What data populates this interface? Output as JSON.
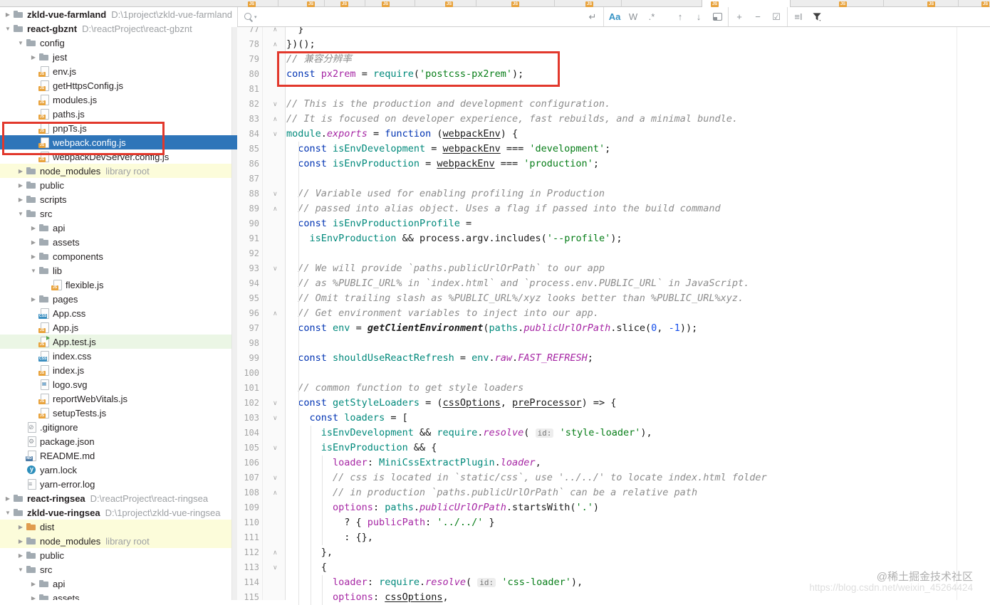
{
  "find_bar": {
    "search_placeholder": "",
    "search_value": "",
    "newline_label": "↵",
    "match_case_label": "Aa",
    "whole_words_label": "W",
    "regex_label": ".*",
    "prev_label": "↑",
    "next_label": "↓",
    "add_selection_label": "+",
    "remove_selection_label": "−",
    "select_all_label": "☑",
    "filter_lines_label": "≡I",
    "icons": [
      "search-icon",
      "search-history-caret",
      "newline-icon",
      "match-case",
      "whole-words",
      "regex",
      "previous-occurrence",
      "next-occurrence",
      "open-in-find-window",
      "add-selection",
      "remove-selection",
      "select-all-occurrences",
      "filter-search-lines",
      "filter"
    ]
  },
  "project_tree": {
    "items": [
      {
        "label": "zkld-vue-farmland",
        "path": "D:\\1project\\zkld-vue-farmland",
        "depth": 0,
        "arrow": "right",
        "icon": "folder",
        "bold": true
      },
      {
        "label": "react-gbznt",
        "path": "D:\\reactProject\\react-gbznt",
        "depth": 0,
        "arrow": "down",
        "icon": "folder",
        "bold": true
      },
      {
        "label": "config",
        "depth": 1,
        "arrow": "down",
        "icon": "folder"
      },
      {
        "label": "jest",
        "depth": 2,
        "arrow": "right",
        "icon": "folder"
      },
      {
        "label": "env.js",
        "depth": 2,
        "icon": "js"
      },
      {
        "label": "getHttpsConfig.js",
        "depth": 2,
        "icon": "js"
      },
      {
        "label": "modules.js",
        "depth": 2,
        "icon": "js"
      },
      {
        "label": "paths.js",
        "depth": 2,
        "icon": "js"
      },
      {
        "label": "pnpTs.js",
        "depth": 2,
        "icon": "js"
      },
      {
        "label": "webpack.config.js",
        "depth": 2,
        "icon": "js",
        "selected": true
      },
      {
        "label": "webpackDevServer.config.js",
        "depth": 2,
        "icon": "js"
      },
      {
        "label": "node_modules",
        "badge": "library root",
        "depth": 1,
        "arrow": "right",
        "icon": "folder",
        "bg": "yellow"
      },
      {
        "label": "public",
        "depth": 1,
        "arrow": "right",
        "icon": "folder"
      },
      {
        "label": "scripts",
        "depth": 1,
        "arrow": "right",
        "icon": "folder"
      },
      {
        "label": "src",
        "depth": 1,
        "arrow": "down",
        "icon": "folder"
      },
      {
        "label": "api",
        "depth": 2,
        "arrow": "right",
        "icon": "folder"
      },
      {
        "label": "assets",
        "depth": 2,
        "arrow": "right",
        "icon": "folder"
      },
      {
        "label": "components",
        "depth": 2,
        "arrow": "right",
        "icon": "folder"
      },
      {
        "label": "lib",
        "depth": 2,
        "arrow": "down",
        "icon": "folder"
      },
      {
        "label": "flexible.js",
        "depth": 3,
        "icon": "js"
      },
      {
        "label": "pages",
        "depth": 2,
        "arrow": "right",
        "icon": "folder"
      },
      {
        "label": "App.css",
        "depth": 2,
        "icon": "css"
      },
      {
        "label": "App.js",
        "depth": 2,
        "icon": "js"
      },
      {
        "label": "App.test.js",
        "depth": 2,
        "icon": "jstest",
        "bg": "green"
      },
      {
        "label": "index.css",
        "depth": 2,
        "icon": "css"
      },
      {
        "label": "index.js",
        "depth": 2,
        "icon": "js"
      },
      {
        "label": "logo.svg",
        "depth": 2,
        "icon": "img"
      },
      {
        "label": "reportWebVitals.js",
        "depth": 2,
        "icon": "js"
      },
      {
        "label": "setupTests.js",
        "depth": 2,
        "icon": "js"
      },
      {
        "label": ".gitignore",
        "depth": 1,
        "icon": "git"
      },
      {
        "label": "package.json",
        "depth": 1,
        "icon": "json"
      },
      {
        "label": "README.md",
        "depth": 1,
        "icon": "md"
      },
      {
        "label": "yarn.lock",
        "depth": 1,
        "icon": "yarn"
      },
      {
        "label": "yarn-error.log",
        "depth": 1,
        "icon": "log"
      },
      {
        "label": "react-ringsea",
        "path": "D:\\reactProject\\react-ringsea",
        "depth": 0,
        "arrow": "right",
        "icon": "folder",
        "bold": true
      },
      {
        "label": "zkld-vue-ringsea",
        "path": "D:\\1project\\zkld-vue-ringsea",
        "depth": 0,
        "arrow": "down",
        "icon": "folder",
        "bold": true
      },
      {
        "label": "dist",
        "depth": 1,
        "arrow": "right",
        "icon": "folder-orange",
        "bg": "yellow"
      },
      {
        "label": "node_modules",
        "badge": "library root",
        "depth": 1,
        "arrow": "right",
        "icon": "folder",
        "bg": "yellow"
      },
      {
        "label": "public",
        "depth": 1,
        "arrow": "right",
        "icon": "folder"
      },
      {
        "label": "src",
        "depth": 1,
        "arrow": "down",
        "icon": "folder"
      },
      {
        "label": "api",
        "depth": 2,
        "arrow": "right",
        "icon": "folder"
      },
      {
        "label": "assets",
        "depth": 2,
        "arrow": "right",
        "icon": "folder"
      }
    ]
  },
  "editor": {
    "file": "webpack.config.js",
    "lines": [
      {
        "n": 77,
        "f": "e",
        "s": [
          [
            "  }",
            "d"
          ]
        ]
      },
      {
        "n": 78,
        "f": "e",
        "s": [
          [
            "})();",
            "d"
          ]
        ]
      },
      {
        "n": 79,
        "s": [
          [
            "// 兼容分辨率",
            "c"
          ]
        ]
      },
      {
        "n": 80,
        "s": [
          [
            "const ",
            "k"
          ],
          [
            "px2rem",
            "p"
          ],
          [
            " = ",
            "d"
          ],
          [
            "require",
            "t"
          ],
          [
            "(",
            "d"
          ],
          [
            "'postcss-px2rem'",
            "s"
          ],
          [
            ");",
            "d"
          ]
        ]
      },
      {
        "n": 81,
        "s": []
      },
      {
        "n": 82,
        "f": "s",
        "s": [
          [
            "// This is the production and development configuration.",
            "c"
          ]
        ]
      },
      {
        "n": 83,
        "f": "e",
        "s": [
          [
            "// It is focused on developer experience, fast rebuilds, and a minimal bundle.",
            "c"
          ]
        ]
      },
      {
        "n": 84,
        "f": "s",
        "s": [
          [
            "module",
            "t"
          ],
          [
            ".",
            "d"
          ],
          [
            "exports",
            "pi"
          ],
          [
            " = ",
            "d"
          ],
          [
            "function",
            "k"
          ],
          [
            " (",
            "d"
          ],
          [
            "webpackEnv",
            "u"
          ],
          [
            ") {",
            "d"
          ]
        ]
      },
      {
        "n": 85,
        "s": [
          [
            "  ",
            "d"
          ],
          [
            "const ",
            "k"
          ],
          [
            "isEnvDevelopment",
            "t"
          ],
          [
            " = ",
            "d"
          ],
          [
            "webpackEnv",
            "u"
          ],
          [
            " === ",
            "d"
          ],
          [
            "'development'",
            "s"
          ],
          [
            ";",
            "d"
          ]
        ]
      },
      {
        "n": 86,
        "s": [
          [
            "  ",
            "d"
          ],
          [
            "const ",
            "k"
          ],
          [
            "isEnvProduction",
            "t"
          ],
          [
            " = ",
            "d"
          ],
          [
            "webpackEnv",
            "u"
          ],
          [
            " === ",
            "d"
          ],
          [
            "'production'",
            "s"
          ],
          [
            ";",
            "d"
          ]
        ]
      },
      {
        "n": 87,
        "s": []
      },
      {
        "n": 88,
        "f": "s",
        "s": [
          [
            "  // Variable used for enabling profiling in Production",
            "c"
          ]
        ]
      },
      {
        "n": 89,
        "f": "e",
        "s": [
          [
            "  // passed into alias object. Uses a flag if passed into the build command",
            "c"
          ]
        ]
      },
      {
        "n": 90,
        "s": [
          [
            "  ",
            "d"
          ],
          [
            "const ",
            "k"
          ],
          [
            "isEnvProductionProfile",
            "t"
          ],
          [
            " =",
            "d"
          ]
        ]
      },
      {
        "n": 91,
        "s": [
          [
            "    ",
            "d"
          ],
          [
            "isEnvProduction",
            "t"
          ],
          [
            " && ",
            "d"
          ],
          [
            "process.argv",
            "d"
          ],
          [
            ".",
            "d"
          ],
          [
            "includes",
            "d"
          ],
          [
            "(",
            "d"
          ],
          [
            "'--profile'",
            "s"
          ],
          [
            ");",
            "d"
          ]
        ]
      },
      {
        "n": 92,
        "s": []
      },
      {
        "n": 93,
        "f": "s",
        "s": [
          [
            "  // We will provide `paths.publicUrlOrPath` to our app",
            "c"
          ]
        ]
      },
      {
        "n": 94,
        "s": [
          [
            "  // as %PUBLIC_URL% in `index.html` and `process.env.PUBLIC_URL` in JavaScript.",
            "c"
          ]
        ]
      },
      {
        "n": 95,
        "s": [
          [
            "  // Omit trailing slash as %PUBLIC_URL%/xyz looks better than %PUBLIC_URL%xyz.",
            "c"
          ]
        ]
      },
      {
        "n": 96,
        "f": "e",
        "s": [
          [
            "  // Get environment variables to inject into our app.",
            "c"
          ]
        ]
      },
      {
        "n": 97,
        "s": [
          [
            "  ",
            "d"
          ],
          [
            "const ",
            "k"
          ],
          [
            "env",
            "t"
          ],
          [
            " = ",
            "d"
          ],
          [
            "getClientEnvironment",
            "fi2"
          ],
          [
            "(",
            "d"
          ],
          [
            "paths",
            "t"
          ],
          [
            ".",
            "d"
          ],
          [
            "publicUrlOrPath",
            "pi"
          ],
          [
            ".",
            "d"
          ],
          [
            "slice",
            "d"
          ],
          [
            "(",
            "d"
          ],
          [
            "0",
            "n"
          ],
          [
            ", ",
            "d"
          ],
          [
            "-1",
            "n"
          ],
          [
            "));",
            "d"
          ]
        ]
      },
      {
        "n": 98,
        "s": []
      },
      {
        "n": 99,
        "s": [
          [
            "  ",
            "d"
          ],
          [
            "const ",
            "k"
          ],
          [
            "shouldUseReactRefresh",
            "t"
          ],
          [
            " = ",
            "d"
          ],
          [
            "env",
            "t"
          ],
          [
            ".",
            "d"
          ],
          [
            "raw",
            "pi"
          ],
          [
            ".",
            "d"
          ],
          [
            "FAST_REFRESH",
            "pi"
          ],
          [
            ";",
            "d"
          ]
        ]
      },
      {
        "n": 100,
        "s": []
      },
      {
        "n": 101,
        "s": [
          [
            "  // common function to get style loaders",
            "c"
          ]
        ]
      },
      {
        "n": 102,
        "f": "s",
        "s": [
          [
            "  ",
            "d"
          ],
          [
            "const ",
            "k"
          ],
          [
            "getStyleLoaders",
            "t"
          ],
          [
            " = (",
            "d"
          ],
          [
            "cssOptions",
            "u"
          ],
          [
            ", ",
            "d"
          ],
          [
            "preProcessor",
            "u"
          ],
          [
            ") => {",
            "d"
          ]
        ]
      },
      {
        "n": 103,
        "f": "s",
        "s": [
          [
            "    ",
            "d"
          ],
          [
            "const ",
            "k"
          ],
          [
            "loaders",
            "t"
          ],
          [
            " = [",
            "d"
          ]
        ]
      },
      {
        "n": 104,
        "s": [
          [
            "      ",
            "d"
          ],
          [
            "isEnvDevelopment",
            "t"
          ],
          [
            " && ",
            "d"
          ],
          [
            "require",
            "t"
          ],
          [
            ".",
            "d"
          ],
          [
            "resolve",
            "pi"
          ],
          [
            "( ",
            "d"
          ],
          [
            "id:",
            "h"
          ],
          [
            " ",
            "d"
          ],
          [
            "'style-loader'",
            "s"
          ],
          [
            "),",
            "d"
          ]
        ]
      },
      {
        "n": 105,
        "f": "s",
        "s": [
          [
            "      ",
            "d"
          ],
          [
            "isEnvProduction",
            "t"
          ],
          [
            " && {",
            "d"
          ]
        ]
      },
      {
        "n": 106,
        "s": [
          [
            "        ",
            "d"
          ],
          [
            "loader",
            "p"
          ],
          [
            ": ",
            "d"
          ],
          [
            "MiniCssExtractPlugin",
            "t"
          ],
          [
            ".",
            "d"
          ],
          [
            "loader",
            "pi"
          ],
          [
            ",",
            "d"
          ]
        ]
      },
      {
        "n": 107,
        "f": "s",
        "s": [
          [
            "        // css is located in `static/css`, use '../../' to locate index.html folder",
            "c"
          ]
        ]
      },
      {
        "n": 108,
        "f": "e",
        "s": [
          [
            "        // in production `paths.publicUrlOrPath` can be a relative path",
            "c"
          ]
        ]
      },
      {
        "n": 109,
        "s": [
          [
            "        ",
            "d"
          ],
          [
            "options",
            "p"
          ],
          [
            ": ",
            "d"
          ],
          [
            "paths",
            "t"
          ],
          [
            ".",
            "d"
          ],
          [
            "publicUrlOrPath",
            "pi"
          ],
          [
            ".",
            "d"
          ],
          [
            "startsWith",
            "d"
          ],
          [
            "(",
            "d"
          ],
          [
            "'.'",
            "s"
          ],
          [
            ")",
            "d"
          ]
        ]
      },
      {
        "n": 110,
        "s": [
          [
            "          ? { ",
            "d"
          ],
          [
            "publicPath",
            "p"
          ],
          [
            ": ",
            "d"
          ],
          [
            "'../../'",
            "s"
          ],
          [
            " }",
            "d"
          ]
        ]
      },
      {
        "n": 111,
        "s": [
          [
            "          : {},",
            "d"
          ]
        ]
      },
      {
        "n": 112,
        "f": "e",
        "s": [
          [
            "      },",
            "d"
          ]
        ]
      },
      {
        "n": 113,
        "f": "s",
        "s": [
          [
            "      {",
            "d"
          ]
        ]
      },
      {
        "n": 114,
        "s": [
          [
            "        ",
            "d"
          ],
          [
            "loader",
            "p"
          ],
          [
            ": ",
            "d"
          ],
          [
            "require",
            "t"
          ],
          [
            ".",
            "d"
          ],
          [
            "resolve",
            "pi"
          ],
          [
            "( ",
            "d"
          ],
          [
            "id:",
            "h"
          ],
          [
            " ",
            "d"
          ],
          [
            "'css-loader'",
            "s"
          ],
          [
            "),",
            "d"
          ]
        ]
      },
      {
        "n": 115,
        "s": [
          [
            "        ",
            "d"
          ],
          [
            "options",
            "p"
          ],
          [
            ": ",
            "d"
          ],
          [
            "cssOptions",
            "u"
          ],
          [
            ",",
            "d"
          ]
        ]
      }
    ]
  },
  "annotations": {
    "color": "#e2382c",
    "boxes": [
      {
        "target": "tree rows pnpTs.js and webpack.config.js"
      },
      {
        "target": "code lines 79-80 (px2rem require)"
      }
    ]
  },
  "watermark": {
    "line1": "@稀土掘金技术社区",
    "line2": "https://blog.csdn.net/weixin_45264424"
  },
  "colors": {
    "selection_blue": "#2e75b9",
    "row_yellow": "#fcfcda",
    "row_green": "#ebf6e5",
    "keyword": "#0033b3",
    "string": "#067d17",
    "comment": "#8c8c8c",
    "purple": "#a626a4",
    "teal": "#00897b",
    "annotation_red": "#e2382c",
    "js_badge_orange": "#e8a33d"
  }
}
